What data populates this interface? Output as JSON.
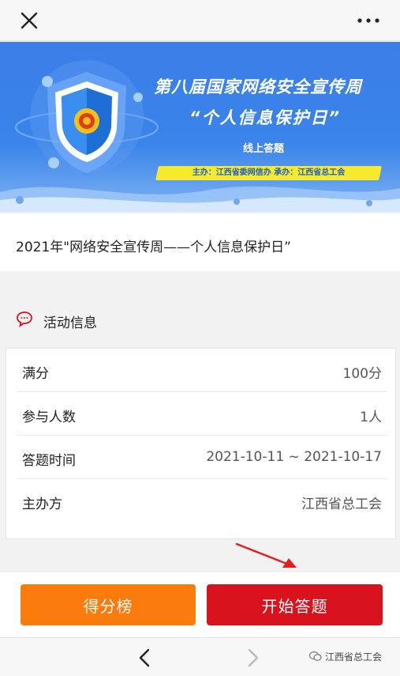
{
  "topbar": {
    "close_icon": "close-icon",
    "more_icon": "more-dots-icon"
  },
  "banner": {
    "line1": "第八届国家网络安全宣传周",
    "line2": "“个人信息保护日”",
    "line3": "线上答题",
    "organizers": "主办：江西省委网信办   承办：江西省总工会"
  },
  "title": "2021年\"网络安全宣传周——个人信息保护日”",
  "section": {
    "label": "活动信息",
    "icon": "speech-bubble-icon"
  },
  "info_rows": [
    {
      "key": "满分",
      "value": "100分"
    },
    {
      "key": "参与人数",
      "value": "1人"
    },
    {
      "key": "答题时间",
      "value": "2021-10-11 ~ 2021-10-17"
    },
    {
      "key": "主办方",
      "value": "江西省总工会"
    }
  ],
  "buttons": {
    "rank": "得分榜",
    "start": "开始答题"
  },
  "navbar": {
    "watermark": "江西省总工会"
  },
  "colors": {
    "rank_button": "#fb7c0c",
    "start_button": "#d9131d",
    "banner_blue": "#3b7ee8",
    "accent_red": "#d9131d"
  }
}
